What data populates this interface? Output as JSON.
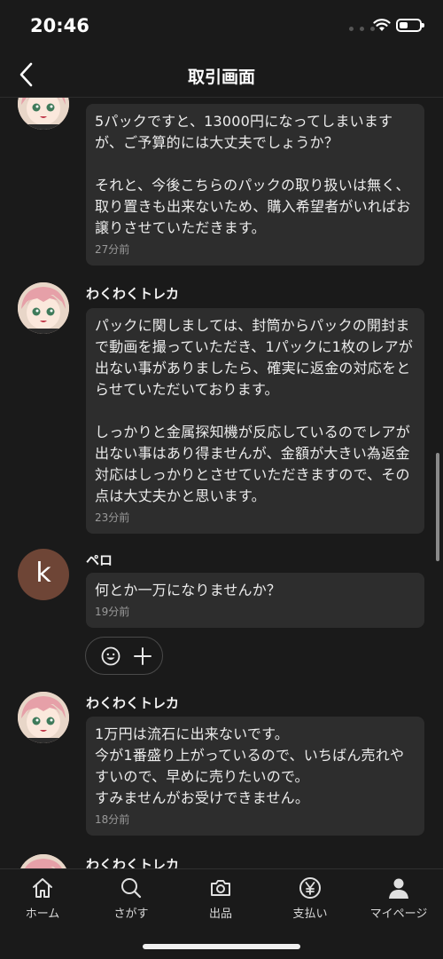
{
  "status_bar": {
    "time": "20:46"
  },
  "header": {
    "title": "取引画面"
  },
  "messages": [
    {
      "sender": "",
      "text": "5パックですと、13000円になってしまいますが、ご予算的には大丈夫でしょうか？\n\nそれと、今後こちらのパックの取り扱いは無く、取り置きも出来ないため、購入希望者がいればお譲りさせていただきます。",
      "time": "27分前"
    },
    {
      "sender": "わくわくトレカ",
      "text": "パックに関しましては、封筒からパックの開封まで動画を撮っていただき、1パックに1枚のレアが出ない事がありましたら、確実に返金の対応をとらせていただいております。\n\nしっかりと金属探知機が反応しているのでレアが出ない事はあり得ませんが、金額が大きい為返金対応はしっかりとさせていただきますので、その点は大丈夫かと思います。",
      "time": "23分前"
    },
    {
      "sender": "ペロ",
      "avatar_letter": "k",
      "text": "何とか一万になりませんか？",
      "time": "19分前"
    },
    {
      "sender": "わくわくトレカ",
      "text": "1万円は流石に出来ないです。\n今が1番盛り上がっているので、いちばん売れやすいので、早めに売りたいので。\nすみませんがお受けできません。",
      "time": "18分前"
    },
    {
      "sender": "わくわくトレカ"
    }
  ],
  "tabs": [
    {
      "label": "ホーム",
      "icon": "home-icon"
    },
    {
      "label": "さがす",
      "icon": "search-icon"
    },
    {
      "label": "出品",
      "icon": "camera-icon"
    },
    {
      "label": "支払い",
      "icon": "yen-icon"
    },
    {
      "label": "マイページ",
      "icon": "person-icon"
    }
  ],
  "colors": {
    "background": "#1a1a1a",
    "bubble": "#2d2d2d",
    "text": "#ececec",
    "muted": "#9a9a9a",
    "avatar_k": "#6e4536"
  }
}
